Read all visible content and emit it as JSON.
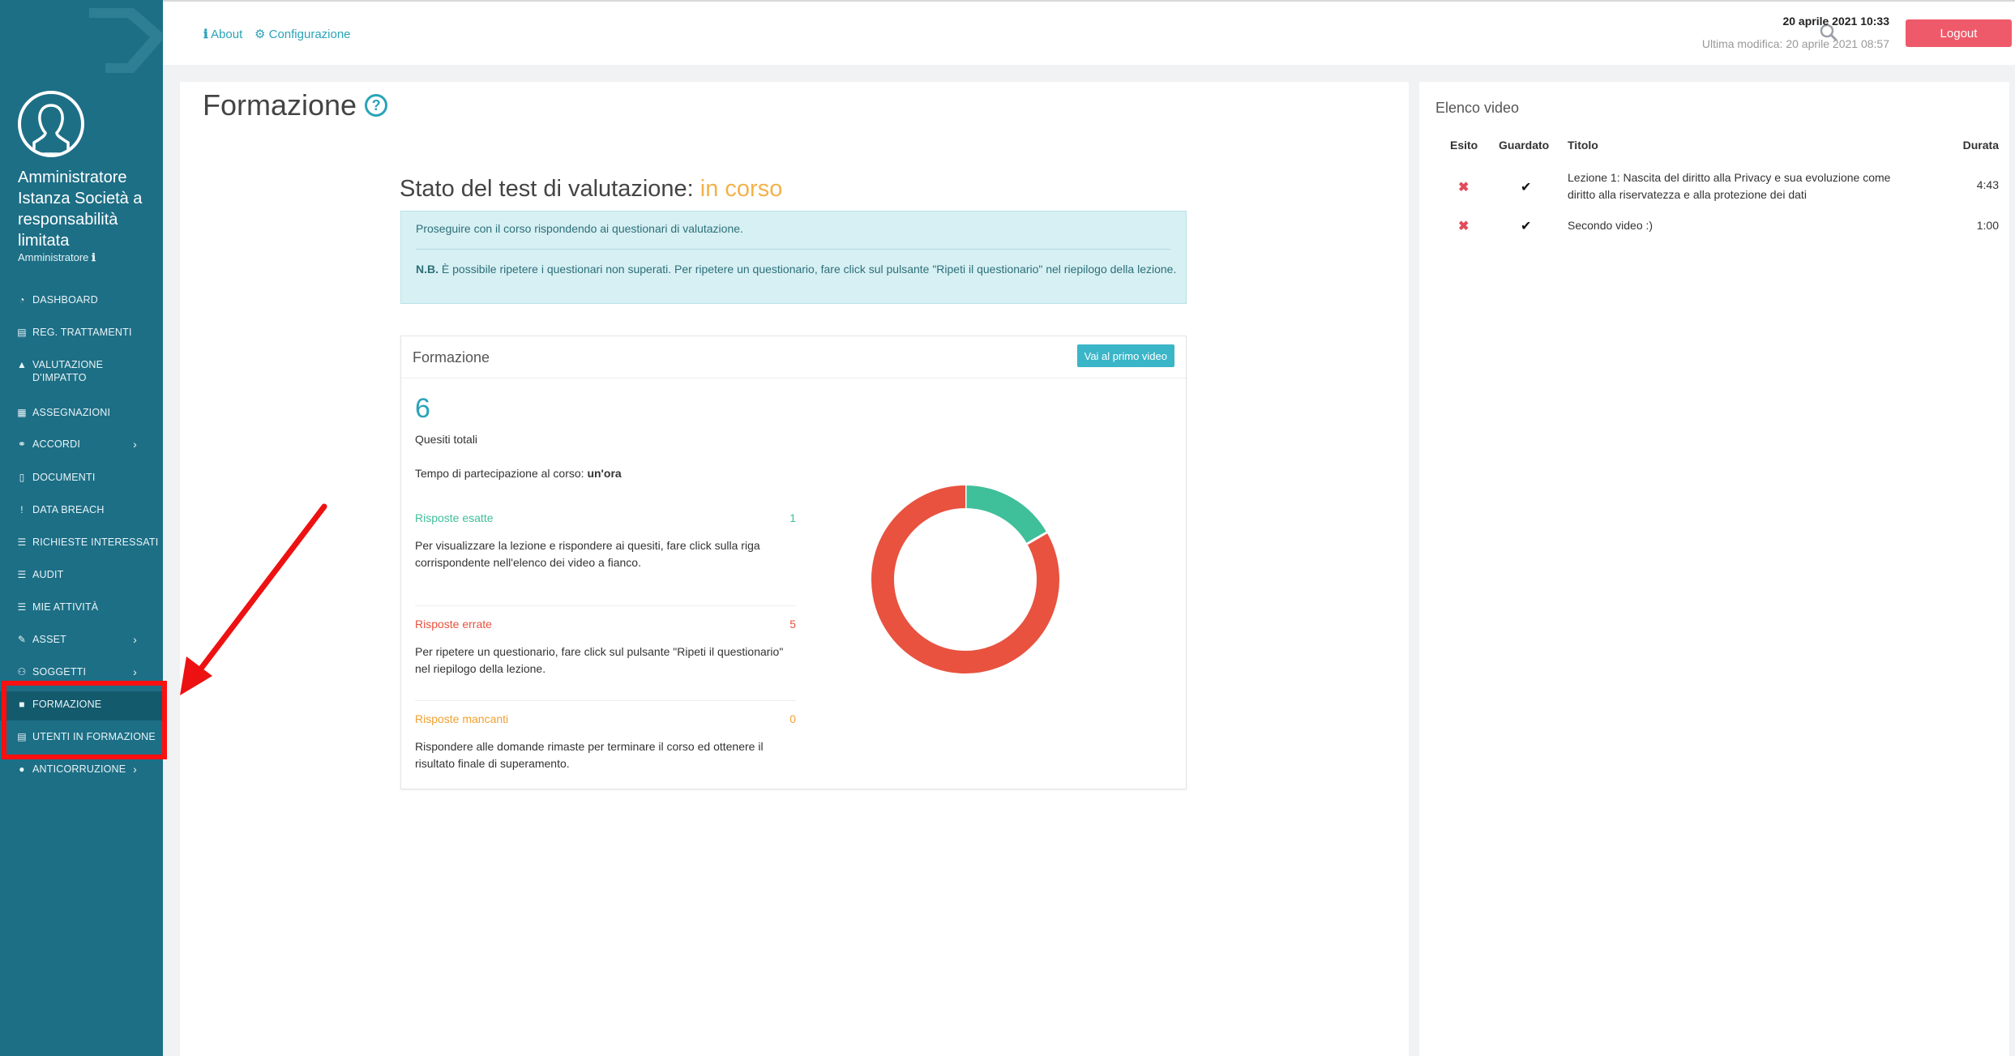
{
  "sidebar": {
    "user_name": "Amministratore Istanza Società a responsabilità limitata",
    "user_role": "Amministratore",
    "items": [
      {
        "label": "DASHBOARD",
        "icon": "dashboard-icon",
        "glyph": "◔",
        "chevron": false
      },
      {
        "label": "REG. TRATTAMENTI",
        "icon": "book-icon",
        "glyph": "▤",
        "chevron": false
      },
      {
        "label": "VALUTAZIONE D'IMPATTO",
        "icon": "warning-icon",
        "glyph": "▲",
        "chevron": false
      },
      {
        "label": "ASSEGNAZIONI",
        "icon": "list-icon",
        "glyph": "▦",
        "chevron": false
      },
      {
        "label": "ACCORDI",
        "icon": "handshake-icon",
        "glyph": "⚭",
        "chevron": true
      },
      {
        "label": "DOCUMENTI",
        "icon": "document-icon",
        "glyph": "▯",
        "chevron": false
      },
      {
        "label": "DATA BREACH",
        "icon": "exclamation-icon",
        "glyph": "!",
        "chevron": false
      },
      {
        "label": "RICHIESTE INTERESSATI",
        "icon": "list-icon",
        "glyph": "☰",
        "chevron": false
      },
      {
        "label": "AUDIT",
        "icon": "list-icon",
        "glyph": "☰",
        "chevron": false
      },
      {
        "label": "MIE ATTIVITÀ",
        "icon": "list-icon",
        "glyph": "☰",
        "chevron": false
      },
      {
        "label": "ASSET",
        "icon": "edit-icon",
        "glyph": "✎",
        "chevron": true
      },
      {
        "label": "SOGGETTI",
        "icon": "users-icon",
        "glyph": "⚇",
        "chevron": true
      },
      {
        "label": "FORMAZIONE",
        "icon": "video-icon",
        "glyph": "■",
        "chevron": false
      },
      {
        "label": "UTENTI IN FORMAZIONE",
        "icon": "list-icon",
        "glyph": "▤",
        "chevron": false
      },
      {
        "label": "ANTICORRUZIONE",
        "icon": "user-icon",
        "glyph": "●",
        "chevron": true
      }
    ]
  },
  "topbar": {
    "about": "About",
    "config": "Configurazione",
    "datetime": "20 aprile 2021 10:33",
    "last_modified": "Ultima modifica: 20 aprile 2021 08:57",
    "logout": "Logout"
  },
  "main": {
    "title": "Formazione",
    "status_label": "Stato del test di valutazione: ",
    "status_value": "in corso",
    "alert_line1": "Proseguire con il corso rispondendo ai questionari di valutazione.",
    "alert_nb": "N.B.",
    "alert_line2": " È possibile ripetere i questionari non superati. Per ripetere un questionario, fare click sul pulsante \"Ripeti il questionario\" nel riepilogo della lezione.",
    "card_title": "Formazione",
    "first_video_button": "Vai al primo video",
    "total_questions": "6",
    "total_questions_label": "Quesiti totali",
    "time_label": "Tempo di partecipazione al corso: ",
    "time_value": "un'ora",
    "stats": [
      {
        "label": "Risposte esatte",
        "count": "1",
        "color": "#3fbf9a",
        "desc": "Per visualizzare la lezione e rispondere ai quesiti, fare click sulla riga corrispondente nell'elenco dei video a fianco."
      },
      {
        "label": "Risposte errate",
        "count": "5",
        "color": "#e8523f",
        "desc": "Per ripetere un questionario, fare click sul pulsante \"Ripeti il questionario\" nel riepilogo della lezione."
      },
      {
        "label": "Risposte mancanti",
        "count": "0",
        "color": "#f0a030",
        "desc": "Rispondere alle domande rimaste per terminare il corso ed ottenere il risultato finale di superamento."
      }
    ]
  },
  "chart_data": {
    "type": "pie",
    "categories": [
      "Risposte esatte",
      "Risposte errate",
      "Risposte mancanti"
    ],
    "values": [
      1,
      5,
      0
    ],
    "colors": [
      "#3fbf9a",
      "#e8523f",
      "#f0a030"
    ]
  },
  "right": {
    "title": "Elenco video",
    "headers": {
      "esito": "Esito",
      "guardato": "Guardato",
      "titolo": "Titolo",
      "durata": "Durata"
    },
    "rows": [
      {
        "esito": "✖",
        "guardato": "✔",
        "titolo": "Lezione 1: Nascita del diritto alla Privacy e sua evoluzione come diritto alla riservatezza e alla protezione dei dati",
        "durata": "4:43"
      },
      {
        "esito": "✖",
        "guardato": "✔",
        "titolo": "Secondo video :)",
        "durata": "1:00"
      }
    ]
  }
}
